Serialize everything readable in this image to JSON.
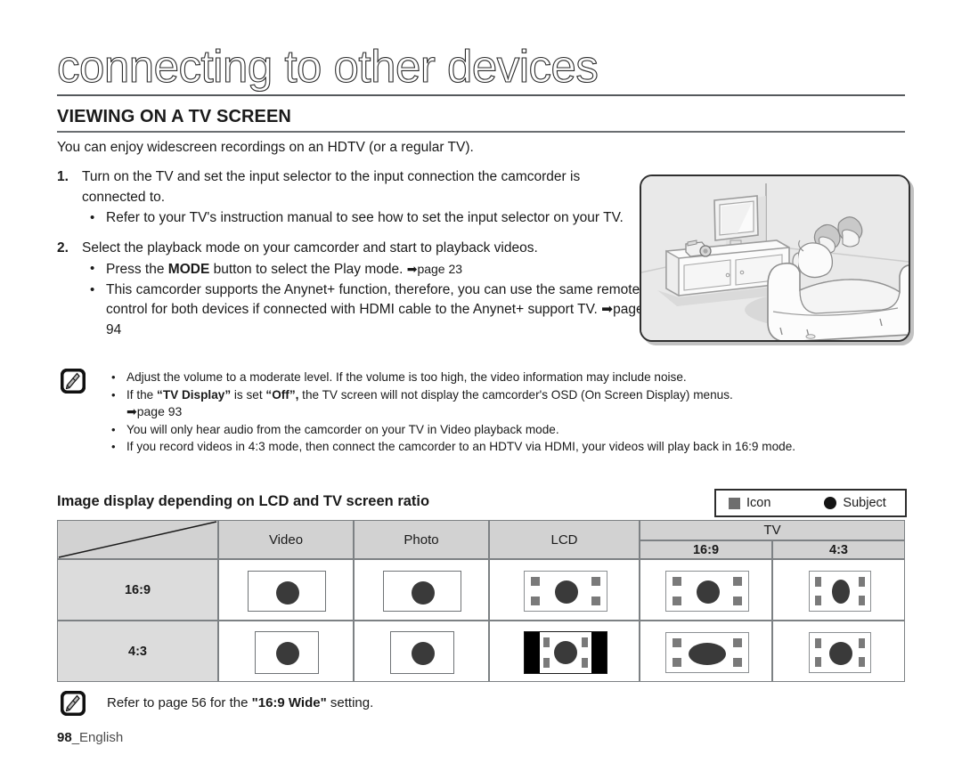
{
  "document": {
    "chapter_title": "connecting to other devices",
    "section_heading": "VIEWING ON A TV SCREEN",
    "intro": "You can enjoy widescreen recordings on an HDTV (or a regular TV)."
  },
  "steps": [
    {
      "number": "1.",
      "text": "Turn on the TV and set the input selector to the input connection the camcorder is connected to.",
      "bullets": [
        "Refer to your TV's instruction manual to see how to set the input selector on your TV."
      ]
    },
    {
      "number": "2.",
      "text": "Select the playback mode on your camcorder and start to playback videos.",
      "bullets": [
        "Press the MODE button to select the Play mode. ➡page 23",
        "This camcorder supports the Anynet+ function, therefore, you can use the same remote control for both devices if connected with HDMI cable to the Anynet+ support TV. ➡page 94"
      ]
    }
  ],
  "step2_bullet1": {
    "pre": "Press the ",
    "bold": "MODE",
    "post": " button to select the Play mode. ",
    "ref": "➡page 23"
  },
  "step2_bullet2": "This camcorder supports the Anynet+ function, therefore, you can use the same remote control for both devices if connected with HDMI cable to the Anynet+ support TV. ➡page 94",
  "notes": {
    "items": [
      "Adjust the volume to a moderate level. If the volume is too high, the video information may include noise.",
      "If the “TV Display” is set “Off”, the TV screen will not display the camcorder's OSD (On Screen Display) menus. ➡page 93",
      "You will only hear audio from the camcorder on your TV in Video playback mode.",
      "If you record videos in 4:3 mode, then connect the camcorder to an HDTV via HDMI, your videos will play back in 16:9 mode."
    ],
    "item2_parts": {
      "p1": "If the ",
      "b1": "“TV Display”",
      "p2": " is set ",
      "b2": "“Off”,",
      "p3": " the TV screen will not display the camcorder's OSD (On Screen Display) menus. ",
      "ref": "➡page 93"
    }
  },
  "table_section": {
    "heading": "Image display depending on LCD and TV screen ratio",
    "legend": [
      {
        "name": "Icon",
        "swatch": "square",
        "color": "#6e6e6e"
      },
      {
        "name": "Subject",
        "swatch": "circle",
        "color": "#141414"
      }
    ],
    "headers": {
      "corner": "",
      "video": "Video",
      "photo": "Photo",
      "lcd": "LCD",
      "tv": "TV",
      "tv_169": "16:9",
      "tv_43": "4:3"
    },
    "rows": [
      {
        "label": "16:9"
      },
      {
        "label": "4:3"
      }
    ]
  },
  "footer": {
    "note_pre": "Refer to page 56 for the ",
    "note_bold": "\"16:9 Wide\"",
    "note_post": " setting.",
    "page_number": "98",
    "page_lang": "_English"
  }
}
